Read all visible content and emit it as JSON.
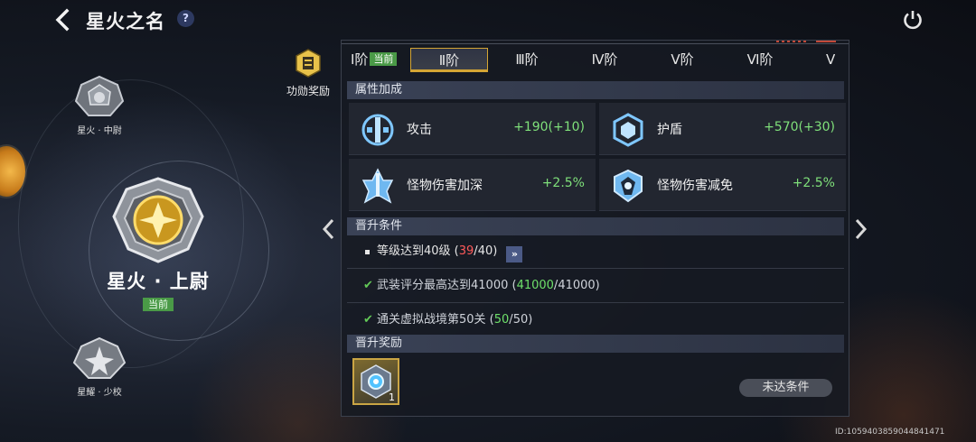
{
  "header": {
    "title": "星火之名",
    "help_label": "?"
  },
  "ranks": {
    "top_label": "星火 · 中尉",
    "main_label": "星火 · 上尉",
    "main_badge": "当前",
    "bottom_label": "星耀 · 少校"
  },
  "merit": {
    "label": "功勋奖励"
  },
  "tabs": [
    {
      "label": "Ⅰ阶",
      "tag": "当前"
    },
    {
      "label": "Ⅱ阶"
    },
    {
      "label": "Ⅲ阶"
    },
    {
      "label": "Ⅳ阶"
    },
    {
      "label": "Ⅴ阶"
    },
    {
      "label": "Ⅵ阶"
    },
    {
      "label": "Ⅶ"
    }
  ],
  "sections": {
    "attributes": "属性加成",
    "conditions": "晋升条件",
    "rewards": "晋升奖励"
  },
  "stats": [
    {
      "name": "攻击",
      "value": "+190",
      "bonus": "(+10)",
      "icon": "attack-icon"
    },
    {
      "name": "护盾",
      "value": "+570",
      "bonus": "(+30)",
      "icon": "shield-icon"
    },
    {
      "name": "怪物伤害加深",
      "value": "+2.5%",
      "icon": "monster-damage-up-icon"
    },
    {
      "name": "怪物伤害减免",
      "value": "+2.5%",
      "icon": "monster-damage-reduce-icon"
    }
  ],
  "conditions": [
    {
      "text": "等级达到40级 (",
      "current": "39",
      "sep": "/",
      "target": "40",
      "end": ")",
      "done": false,
      "goto": "»"
    },
    {
      "text": "武装评分最高达到41000 (",
      "current": "41000",
      "sep": "/",
      "target": "41000",
      "end": ")",
      "done": true
    },
    {
      "text": "通关虚拟战境第50关 (",
      "current": "50",
      "sep": "/",
      "target": "50",
      "end": ")",
      "done": true
    }
  ],
  "reward": {
    "quantity": "1",
    "button_label": "未达条件"
  },
  "footer": {
    "uid": "ID:1059403859044841471"
  },
  "colors": {
    "accent_gold": "#d4a534",
    "green": "#6ee06a",
    "red": "#ff5a5a",
    "current_badge": "#4a9a47"
  }
}
